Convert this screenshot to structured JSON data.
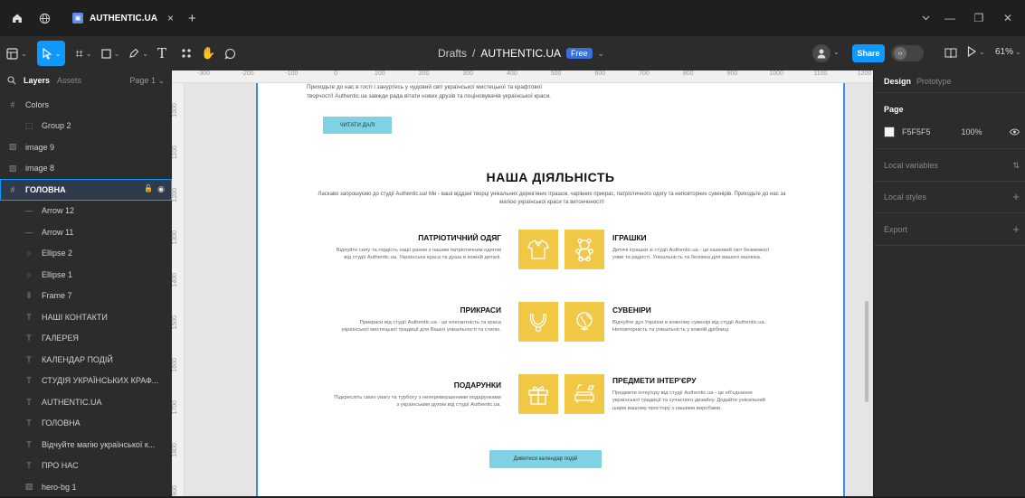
{
  "window": {
    "tab_title": "AUTHENTIC.UA",
    "tab_close": "×",
    "new_tab": "+",
    "minimize": "—",
    "maximize": "❐",
    "close": "✕"
  },
  "toolbar": {
    "breadcrumb_folder": "Drafts",
    "separator": "/",
    "file_name": "AUTHENTIC.UA",
    "plan_badge": "Free",
    "share_label": "Share",
    "zoom": "61%"
  },
  "layers_panel": {
    "tab_layers": "Layers",
    "tab_assets": "Assets",
    "page_selector": "Page 1",
    "items": [
      {
        "label": "Colors",
        "icon": "frame-icon",
        "indent": 0
      },
      {
        "label": "Group 2",
        "icon": "group-icon",
        "indent": 1
      },
      {
        "label": "image 9",
        "icon": "image-icon",
        "indent": 0
      },
      {
        "label": "image 8",
        "icon": "image-icon",
        "indent": 0
      },
      {
        "label": "ГОЛОВНА",
        "icon": "frame-icon",
        "indent": 0
      },
      {
        "label": "Arrow 12",
        "icon": "line-icon",
        "indent": 1
      },
      {
        "label": "Arrow 11",
        "icon": "line-icon",
        "indent": 1
      },
      {
        "label": "Ellipse 2",
        "icon": "ellipse-icon",
        "indent": 1
      },
      {
        "label": "Ellipse 1",
        "icon": "ellipse-icon",
        "indent": 1
      },
      {
        "label": "Frame 7",
        "icon": "columns-icon",
        "indent": 1
      },
      {
        "label": "НАШІ КОНТАКТИ",
        "icon": "text-icon",
        "indent": 1
      },
      {
        "label": "ГАЛЕРЕЯ",
        "icon": "text-icon",
        "indent": 1
      },
      {
        "label": "КАЛЕНДАР ПОДІЙ",
        "icon": "text-icon",
        "indent": 1
      },
      {
        "label": "СТУДІЯ УКРАЇНСЬКИХ КРАФ...",
        "icon": "text-icon",
        "indent": 1
      },
      {
        "label": "AUTHENTIC.UA",
        "icon": "text-icon",
        "indent": 1
      },
      {
        "label": "ГОЛОВНА",
        "icon": "text-icon",
        "indent": 1
      },
      {
        "label": "Відчуйте магію української к...",
        "icon": "text-icon",
        "indent": 1
      },
      {
        "label": "ПРО НАС",
        "icon": "text-icon",
        "indent": 1
      },
      {
        "label": "hero-bg 1",
        "icon": "image-icon",
        "indent": 1
      }
    ]
  },
  "rulers": {
    "horizontal": [
      "-300",
      "-200",
      "-100",
      "0",
      "100",
      "200",
      "300",
      "400",
      "500",
      "600",
      "700",
      "800",
      "900",
      "1000",
      "1100",
      "1200",
      "1300"
    ],
    "vertical": [
      "1000",
      "1100",
      "1200",
      "1300",
      "1400",
      "1500",
      "1600",
      "1700",
      "1800",
      "1900"
    ]
  },
  "design": {
    "intro_text": "Приходьте до нас в гості і зануртесь у чудовий світ української мистецької та крафтової творчості! Authentic.ua завжди рада вітати нових друзів та поціновувачів української краси.",
    "read_more": "ЧИТАТИ ДАЛІ",
    "section_title": "НАША ДІЯЛЬНІСТЬ",
    "section_subtitle": "Ласкаво запрошуємо до студії Authentic.ua! Ми - ваші віддані творці унікальних дерев'яних іграшок, чарівних прикрас, патріотичного одягу та неповторних сувенірів. Приходьте до нас за магією української краси та витонченості!",
    "activities": [
      {
        "title": "ПАТРІОТИЧНИЙ ОДЯГ",
        "desc": "Відчуйте силу та гордість нації разом з нашим патріотичним одягом від студії Authentic.ua. Українська краса та душа в кожній деталі.",
        "icon": "shirt-icon"
      },
      {
        "title": "ІГРАШКИ",
        "desc": "Дитячі іграшки зі студії Authentic.ua - це казковий світ безмежної уяви та радості. Унікальність та безпека для вашого малюка.",
        "icon": "teddy-bear-icon"
      },
      {
        "title": "ПРИКРАСИ",
        "desc": "Прикраси від студії Authentic.ua - це елегантність та краса української мистецької традиції для Вашої унікальності та стилю.",
        "icon": "necklace-icon"
      },
      {
        "title": "СУВЕНІРИ",
        "desc": "Відчуйте дух України в кожному сувенірі від студії Authentic.ua. Неповторність та унікальність у кожній дрібниці.",
        "icon": "globe-pin-icon"
      },
      {
        "title": "ПОДАРУНКИ",
        "desc": "Підкресліть свою увагу та турботу з неперевершеними подарунками з українським духом від студії Authentic.ua.",
        "icon": "gift-icon"
      },
      {
        "title": "ПРЕДМЕТИ ІНТЕР'ЄРУ",
        "desc": "Предмети інтер'єру від студії Authentic.ua - це об'єднання української традиції та сучасного дизайну. Додайте унікальний шарм вашому простору з нашими виробами.",
        "icon": "sofa-lamp-icon"
      }
    ],
    "calendar_button": "Дивитися календар подій",
    "accent_yellow": "#F0C845",
    "accent_cyan": "#7FD2E4"
  },
  "properties_panel": {
    "tab_design": "Design",
    "tab_prototype": "Prototype",
    "page_heading": "Page",
    "page_color": "F5F5F5",
    "page_opacity": "100%",
    "local_variables": "Local variables",
    "local_styles": "Local styles",
    "export": "Export",
    "add_icon": "+"
  }
}
